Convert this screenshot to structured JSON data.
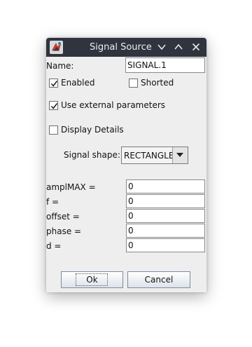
{
  "window": {
    "title": "Signal Source",
    "controls": [
      "chevron-down-icon",
      "chevron-up-icon",
      "close-icon"
    ]
  },
  "name_row": {
    "label": "Name:",
    "value": "SIGNAL.1"
  },
  "checkboxes": {
    "enabled": {
      "label": "Enabled",
      "checked": true
    },
    "shorted": {
      "label": "Shorted",
      "checked": false
    },
    "use_external": {
      "label": "Use external parameters",
      "checked": true
    },
    "display_details": {
      "label": "Display Details",
      "checked": false
    }
  },
  "signal_shape": {
    "label": "Signal shape:",
    "value": "RECTANGLE"
  },
  "params": [
    {
      "label": "amplMAX =",
      "value": "0"
    },
    {
      "label": "f =",
      "value": "0"
    },
    {
      "label": "offset =",
      "value": "0"
    },
    {
      "label": "phase =",
      "value": "0"
    },
    {
      "label": "d =",
      "value": "0"
    }
  ],
  "buttons": {
    "ok": "Ok",
    "cancel": "Cancel"
  },
  "colors": {
    "titlebar": "#2f343f",
    "dialog_bg": "#eeeeee",
    "button_border": "#7c8ca0"
  }
}
